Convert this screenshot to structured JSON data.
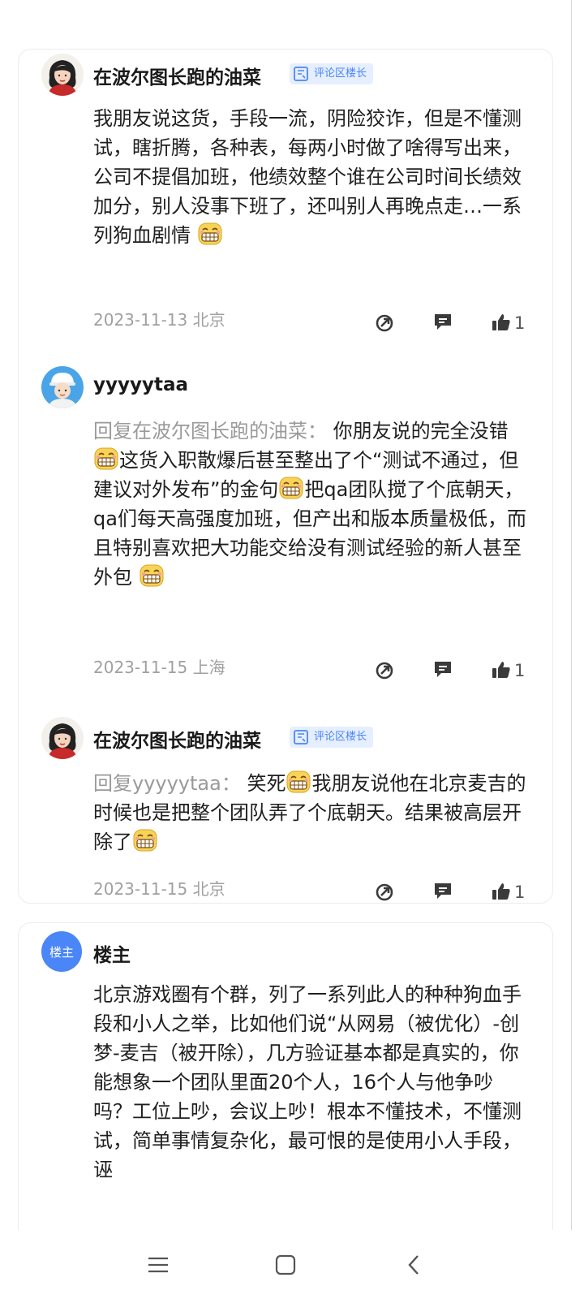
{
  "comments": [
    {
      "username": "在波尔图长跑的油菜",
      "badge": "评论区楼长",
      "text_parts": [
        "我朋友说这货，手段一流，阴险狡诈，但是不懂测试，瞎折腾，各种表，每两小时做了啥得写出来，公司不提倡加班，他绩效整个谁在公司时间长绩效加分，别人没事下班了，还叫别人再晚点走…一系列狗血剧情"
      ],
      "date": "2023-11-13",
      "location": "北京",
      "likes": "1"
    },
    {
      "username": "yyyyytaa",
      "reply_prefix": "回复在波尔图长跑的油菜：",
      "text_parts": [
        "你朋友说的完全没错",
        "这货入职散爆后甚至整出了个“测试不通过，但建议对外发布”的金句",
        "把qa团队搅了个底朝天，qa们每天高强度加班，但产出和版本质量极低，而且特别喜欢把大功能交给没有测试经验的新人甚至外包"
      ],
      "date": "2023-11-15",
      "location": "上海",
      "likes": "1"
    },
    {
      "username": "在波尔图长跑的油菜",
      "badge": "评论区楼长",
      "reply_prefix": "回复yyyyytaa：",
      "text_parts": [
        "笑死",
        "我朋友说他在北京麦吉的时候也是把整个团队弄了个底朝天。结果被高层开除了"
      ],
      "date": "2023-11-15",
      "location": "北京",
      "likes": "1"
    }
  ],
  "op_comment": {
    "avatar_label": "楼主",
    "username": "楼主",
    "text": "北京游戏圈有个群，列了一系列此人的种种狗血手段和小人之举，比如他们说“从网易（被优化）-创梦-麦吉（被开除），几方验证基本都是真实的，你能想象一个团队里面20个人，16个人与他争吵吗？工位上吵，会议上吵！根本不懂技术，不懂测试，简单事情复杂化，最可恨的是使用小人手段，诬"
  },
  "icons": [
    "share-icon",
    "reply-icon",
    "thumbs-up-icon",
    "menu-icon",
    "home-icon",
    "back-icon",
    "grin-emoji-icon",
    "badge-book-icon"
  ],
  "colors": {
    "badge_bg": "#e6efff",
    "badge_text": "#4a86f7",
    "op_avatar": "#4a86f7",
    "meta": "#a0a0a0",
    "reply_prefix": "#9a9a9a"
  }
}
